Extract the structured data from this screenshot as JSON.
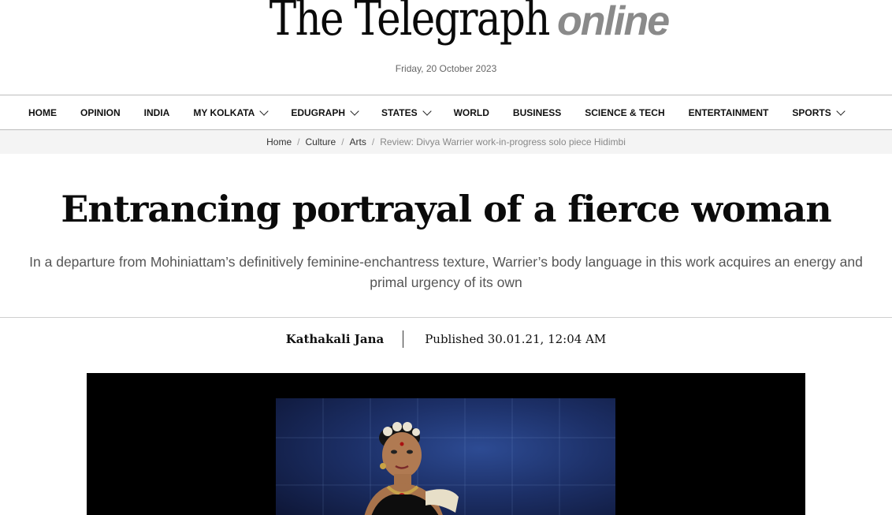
{
  "masthead": {
    "logo_main": "The Telegraph",
    "logo_online": "online",
    "date": "Friday, 20 October 2023"
  },
  "nav": {
    "items": [
      {
        "label": "HOME",
        "dropdown": false
      },
      {
        "label": "OPINION",
        "dropdown": false
      },
      {
        "label": "INDIA",
        "dropdown": false
      },
      {
        "label": "MY KOLKATA",
        "dropdown": true
      },
      {
        "label": "EDUGRAPH",
        "dropdown": true
      },
      {
        "label": "STATES",
        "dropdown": true
      },
      {
        "label": "WORLD",
        "dropdown": false
      },
      {
        "label": "BUSINESS",
        "dropdown": false
      },
      {
        "label": "SCIENCE & TECH",
        "dropdown": false
      },
      {
        "label": "ENTERTAINMENT",
        "dropdown": false
      },
      {
        "label": "SPORTS",
        "dropdown": true
      }
    ]
  },
  "breadcrumb": {
    "items": [
      "Home",
      "Culture",
      "Arts",
      "Review: Divya Warrier work-in-progress solo piece Hidimbi"
    ],
    "separator": "/"
  },
  "article": {
    "headline": "Entrancing portrayal of a fierce woman",
    "standfirst": "In a departure from Mohiniattam’s definitively feminine-enchantress texture, Warrier’s body language in this work acquires an energy and primal urgency of its own",
    "author": "Kathakali Jana",
    "published": "Published 30.01.21, 12:04 AM"
  },
  "colors": {
    "logo_online": "#8a8a8a",
    "breadcrumb_bg": "#f4f4f4",
    "photo_bg": "#1c2f66"
  }
}
